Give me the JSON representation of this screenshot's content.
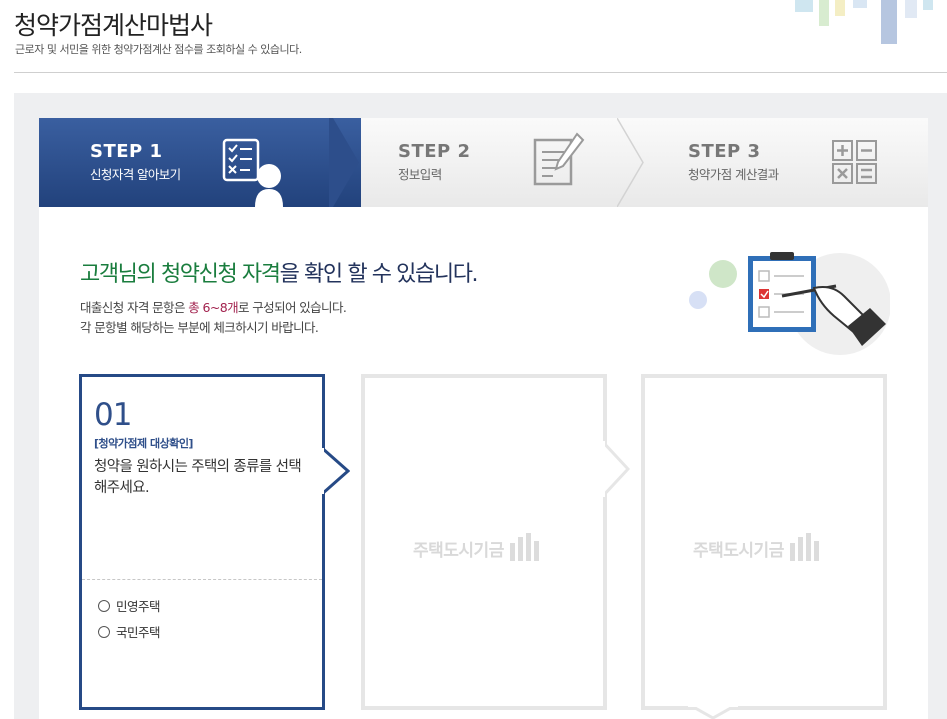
{
  "header": {
    "title": "청약가점계산마법사",
    "subtitle": "근로자 및 서민을 위한 청약가점계산 점수를 조회하실 수 있습니다."
  },
  "steps": [
    {
      "title": "STEP 1",
      "label": "신청자격 알아보기",
      "active": true,
      "icon": "checklist-person-icon"
    },
    {
      "title": "STEP 2",
      "label": "정보입력",
      "active": false,
      "icon": "document-pencil-icon"
    },
    {
      "title": "STEP 3",
      "label": "청약가점 계산결과",
      "active": false,
      "icon": "calculator-icon"
    }
  ],
  "intro": {
    "headline_part1": "고객님의 ",
    "headline_part2": "청약신청 자격",
    "headline_part3": "을 확인 할 수 있습니다.",
    "desc1_a": "대출신청 자격 문항은 ",
    "desc1_hl": "총 6~8개",
    "desc1_b": "로 구성되어 있습니다.",
    "desc2": "각 문항별 해당하는 부분에 체크하시기 바랍니다."
  },
  "cards": {
    "active": {
      "number": "01",
      "category": "[청약가점제 대상확인]",
      "question": "청약을 원하시는 주택의 종류를 선택해주세요.",
      "options": [
        "민영주택",
        "국민주택"
      ]
    },
    "placeholder_text": "주택도시기금"
  },
  "colors": {
    "step_active": "#264a86",
    "headline_green": "#1a7d3e",
    "headline_navy": "#23335c",
    "highlight": "#a2224e"
  }
}
